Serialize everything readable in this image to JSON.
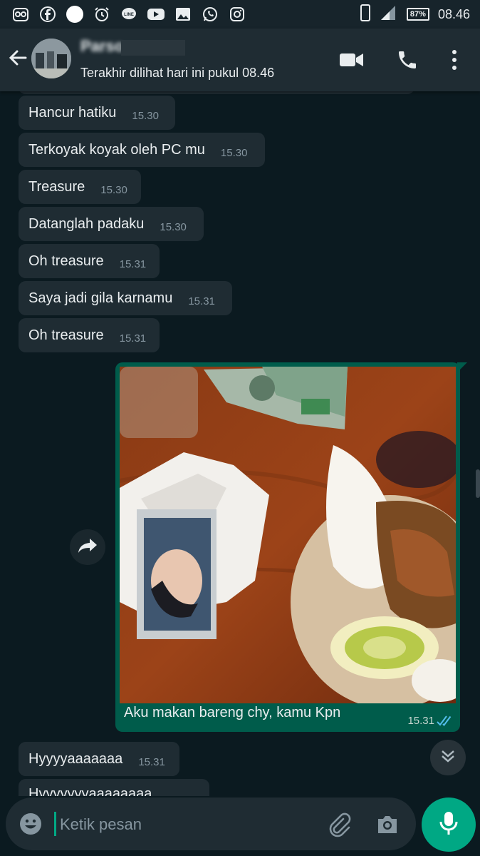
{
  "status_bar": {
    "battery": "87%",
    "time": "08.46",
    "icons": [
      "owl-icon",
      "facebook-icon",
      "circle-icon",
      "alarm-icon",
      "line-icon",
      "youtube-icon",
      "gallery-icon",
      "whatsapp-icon",
      "instagram-icon"
    ]
  },
  "header": {
    "contact_name": "Parso",
    "last_seen": "Terakhir dilihat hari ini pukul 08.46"
  },
  "messages": [
    {
      "text": "Hancur hatiku",
      "time": "15.30"
    },
    {
      "text": "Terkoyak koyak oleh PC mu",
      "time": "15.30"
    },
    {
      "text": "Treasure",
      "time": "15.30"
    },
    {
      "text": "Datanglah padaku",
      "time": "15.30"
    },
    {
      "text": "Oh treasure",
      "time": "15.31"
    },
    {
      "text": "Saya jadi gila karnamu",
      "time": "15.31"
    },
    {
      "text": "Oh treasure",
      "time": "15.31"
    }
  ],
  "image_message": {
    "caption": "Aku makan bareng chy, kamu Kpn",
    "time": "15.31"
  },
  "after_messages": [
    {
      "text": "Hyyyyaaaaaaa",
      "time": "15.31"
    },
    {
      "text": "Hyyyyyyyaaaaaaaa",
      "time": ""
    }
  ],
  "composer": {
    "placeholder": "Ketik pesan"
  },
  "colors": {
    "background": "#0b1a20",
    "incoming_bubble": "#1f2c33",
    "outgoing_bubble": "#005c4b",
    "accent": "#00a884",
    "read_ticks": "#53bdeb"
  }
}
